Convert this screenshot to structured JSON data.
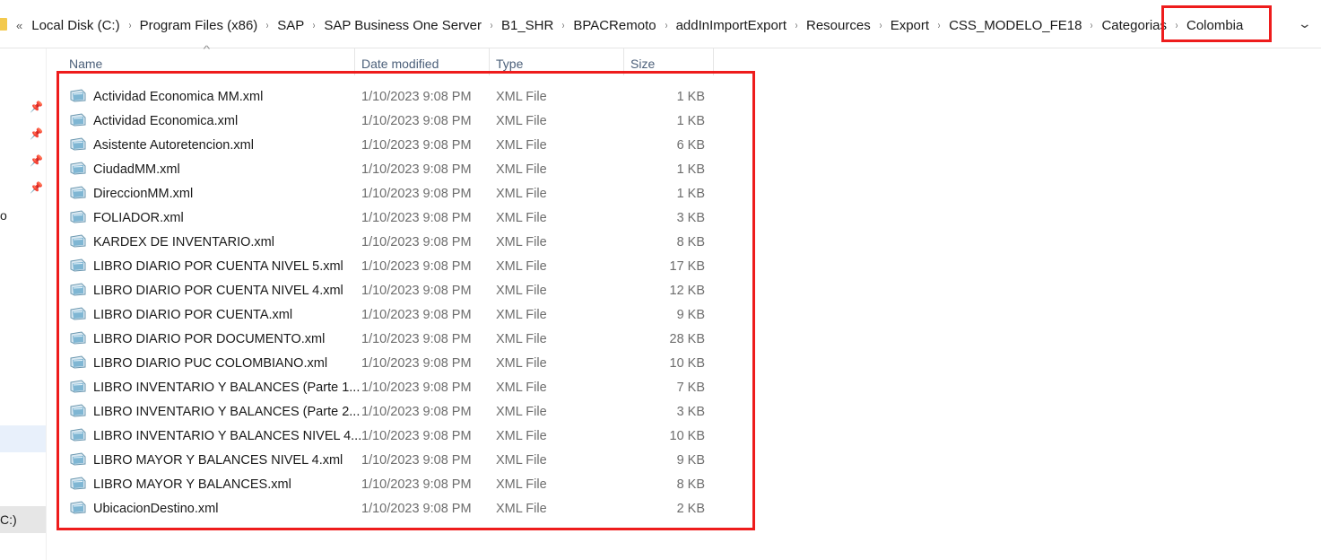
{
  "address_bar": {
    "overflow_label": "«",
    "breadcrumbs": [
      "Local Disk (C:)",
      "Program Files (x86)",
      "SAP",
      "SAP Business One Server",
      "B1_SHR",
      "BPACRemoto",
      "addInImportExport",
      "Resources",
      "Export",
      "CSS_MODELO_FE18",
      "Categorias",
      "Colombia"
    ],
    "separator": "›",
    "dropdown": "⌄"
  },
  "nav_pane": {
    "fragment_o": "o",
    "drive_label": "C:)"
  },
  "columns": {
    "name": "Name",
    "date": "Date modified",
    "type": "Type",
    "size": "Size",
    "sort_indicator": "^"
  },
  "files": [
    {
      "name": "Actividad Economica MM.xml",
      "date": "1/10/2023 9:08 PM",
      "type": "XML File",
      "size": "1 KB"
    },
    {
      "name": "Actividad Economica.xml",
      "date": "1/10/2023 9:08 PM",
      "type": "XML File",
      "size": "1 KB"
    },
    {
      "name": "Asistente Autoretencion.xml",
      "date": "1/10/2023 9:08 PM",
      "type": "XML File",
      "size": "6 KB"
    },
    {
      "name": "CiudadMM.xml",
      "date": "1/10/2023 9:08 PM",
      "type": "XML File",
      "size": "1 KB"
    },
    {
      "name": "DireccionMM.xml",
      "date": "1/10/2023 9:08 PM",
      "type": "XML File",
      "size": "1 KB"
    },
    {
      "name": "FOLIADOR.xml",
      "date": "1/10/2023 9:08 PM",
      "type": "XML File",
      "size": "3 KB"
    },
    {
      "name": "KARDEX DE INVENTARIO.xml",
      "date": "1/10/2023 9:08 PM",
      "type": "XML File",
      "size": "8 KB"
    },
    {
      "name": "LIBRO DIARIO POR CUENTA  NIVEL 5.xml",
      "date": "1/10/2023 9:08 PM",
      "type": "XML File",
      "size": "17 KB"
    },
    {
      "name": "LIBRO DIARIO POR CUENTA NIVEL 4.xml",
      "date": "1/10/2023 9:08 PM",
      "type": "XML File",
      "size": "12 KB"
    },
    {
      "name": "LIBRO DIARIO POR CUENTA.xml",
      "date": "1/10/2023 9:08 PM",
      "type": "XML File",
      "size": "9 KB"
    },
    {
      "name": "LIBRO DIARIO POR DOCUMENTO.xml",
      "date": "1/10/2023 9:08 PM",
      "type": "XML File",
      "size": "28 KB"
    },
    {
      "name": "LIBRO DIARIO PUC COLOMBIANO.xml",
      "date": "1/10/2023 9:08 PM",
      "type": "XML File",
      "size": "10 KB"
    },
    {
      "name": "LIBRO INVENTARIO Y BALANCES (Parte 1...",
      "date": "1/10/2023 9:08 PM",
      "type": "XML File",
      "size": "7 KB"
    },
    {
      "name": "LIBRO INVENTARIO Y BALANCES (Parte 2...",
      "date": "1/10/2023 9:08 PM",
      "type": "XML File",
      "size": "3 KB"
    },
    {
      "name": "LIBRO INVENTARIO Y BALANCES NIVEL 4...",
      "date": "1/10/2023 9:08 PM",
      "type": "XML File",
      "size": "10 KB"
    },
    {
      "name": "LIBRO MAYOR Y BALANCES NIVEL 4.xml",
      "date": "1/10/2023 9:08 PM",
      "type": "XML File",
      "size": "9 KB"
    },
    {
      "name": "LIBRO MAYOR Y BALANCES.xml",
      "date": "1/10/2023 9:08 PM",
      "type": "XML File",
      "size": "8 KB"
    },
    {
      "name": "UbicacionDestino.xml",
      "date": "1/10/2023 9:08 PM",
      "type": "XML File",
      "size": "2 KB"
    }
  ],
  "colors": {
    "annotation_red": "#ee1c1c",
    "folder_yellow": "#f3c94d",
    "header_text": "#4c607a",
    "meta_text": "#6d6d6d"
  },
  "icons": {
    "file": "xml-file-icon",
    "pin": "pin-icon",
    "folder": "folder-icon"
  }
}
